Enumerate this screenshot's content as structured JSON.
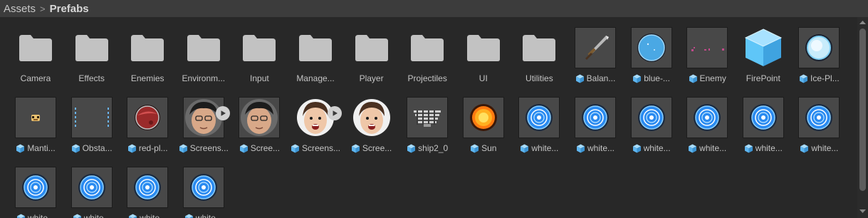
{
  "breadcrumb": {
    "root": "Assets",
    "separator": ">",
    "current": "Prefabs"
  },
  "items": [
    {
      "label": "Camera",
      "kind": "folder"
    },
    {
      "label": "Effects",
      "kind": "folder"
    },
    {
      "label": "Enemies",
      "kind": "folder"
    },
    {
      "label": "Environm...",
      "kind": "folder"
    },
    {
      "label": "Input",
      "kind": "folder"
    },
    {
      "label": "Manage...",
      "kind": "folder"
    },
    {
      "label": "Player",
      "kind": "folder"
    },
    {
      "label": "Projectiles",
      "kind": "folder"
    },
    {
      "label": "UI",
      "kind": "folder"
    },
    {
      "label": "Utilities",
      "kind": "folder"
    },
    {
      "label": "Balan...",
      "kind": "prefab",
      "thumb": "sword"
    },
    {
      "label": "blue-...",
      "kind": "prefab",
      "thumb": "bluecircle"
    },
    {
      "label": "Enemy",
      "kind": "prefab",
      "thumb": "enemy"
    },
    {
      "label": "FirePoint",
      "kind": "prefab-empty",
      "thumb": "cube"
    },
    {
      "label": "Ice-Pl...",
      "kind": "prefab",
      "thumb": "icecircle"
    },
    {
      "label": "Manti...",
      "kind": "prefab",
      "thumb": "mantis"
    },
    {
      "label": "Obsta...",
      "kind": "prefab",
      "thumb": "obstacle"
    },
    {
      "label": "red-pl...",
      "kind": "prefab",
      "thumb": "redplanet"
    },
    {
      "label": "Screens...",
      "kind": "video",
      "thumb": "face1"
    },
    {
      "label": "Scree...",
      "kind": "prefab",
      "thumb": "face1"
    },
    {
      "label": "Screens...",
      "kind": "video",
      "thumb": "face2"
    },
    {
      "label": "Scree...",
      "kind": "prefab",
      "thumb": "face2"
    },
    {
      "label": "ship2_0",
      "kind": "prefab",
      "thumb": "ship"
    },
    {
      "label": "Sun",
      "kind": "prefab",
      "thumb": "sun"
    },
    {
      "label": "white...",
      "kind": "prefab",
      "thumb": "portal"
    },
    {
      "label": "white...",
      "kind": "prefab",
      "thumb": "portal"
    },
    {
      "label": "white...",
      "kind": "prefab",
      "thumb": "portal"
    },
    {
      "label": "white...",
      "kind": "prefab",
      "thumb": "portal"
    },
    {
      "label": "white...",
      "kind": "prefab",
      "thumb": "portal"
    },
    {
      "label": "white...",
      "kind": "prefab",
      "thumb": "portal"
    },
    {
      "label": "white...",
      "kind": "prefab",
      "thumb": "portal"
    },
    {
      "label": "white...",
      "kind": "prefab",
      "thumb": "portal"
    },
    {
      "label": "white...",
      "kind": "prefab",
      "thumb": "portal"
    },
    {
      "label": "white...",
      "kind": "prefab",
      "thumb": "portal"
    }
  ],
  "colors": {
    "folder": "#c2c2c2",
    "prefab_icon": "#5fb6f0",
    "portal_blue": "#2a8af0",
    "sun": "#ff7a10"
  }
}
